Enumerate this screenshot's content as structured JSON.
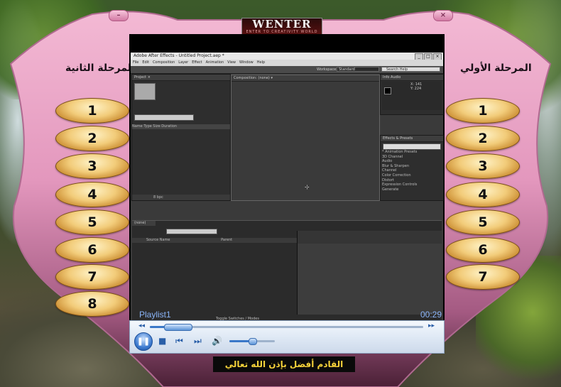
{
  "window": {
    "close_glyph": "×"
  },
  "logo": {
    "text": "WENTER",
    "tagline": "ENTER TO CREATIVITY WORLD"
  },
  "left_column": {
    "title": "المرحلة الثانية",
    "items": [
      "1",
      "2",
      "3",
      "4",
      "5",
      "6",
      "7",
      "8"
    ]
  },
  "right_column": {
    "title": "المرحلة الأولي",
    "items": [
      "1",
      "2",
      "3",
      "4",
      "5",
      "6",
      "7"
    ]
  },
  "video": {
    "app_title": "Adobe After Effects - Untitled Project.aep *",
    "menu": [
      "File",
      "Edit",
      "Composition",
      "Layer",
      "Effect",
      "Animation",
      "View",
      "Window",
      "Help"
    ],
    "workspace_label": "Workspace:",
    "workspace_value": "Standard",
    "search_help": "Search Help",
    "project_tab": "Project ×",
    "comp_tab": "Composition: (none) ▾",
    "info_tab": "Info   Audio",
    "info_values": "X: 141\nY: 224",
    "effects_tab": "Effects & Presets",
    "effects": [
      "* Animation Presets",
      "3D Channel",
      "Audio",
      "Blur & Sharpen",
      "Channel",
      "Color Correction",
      "Distort",
      "Expression Controls",
      "Generate"
    ],
    "project_columns": "Name      Type     Size    Duration",
    "bpc": "8 bpc",
    "timeline_tab": "(none)",
    "timeline_header": "Source Name",
    "timeline_parent": "Parent",
    "timeline_footer": "Toggle Switches / Modes"
  },
  "player": {
    "playlist_title": "Playlist1",
    "elapsed": "00:29",
    "seek_progress": 0.1,
    "volume_level": 0.5,
    "icons": [
      "rewind-icon",
      "fast-forward-icon",
      "pause-icon",
      "stop-icon",
      "previous-icon",
      "next-icon",
      "volume-icon"
    ]
  },
  "caption": "القادم أفضل بإذن الله تعالي",
  "colors": {
    "shield_pink": "#e6a0c4",
    "pill_gold": "#f2cc7a",
    "caption_text": "#f6d23a",
    "player_accent": "#3a78c8"
  }
}
